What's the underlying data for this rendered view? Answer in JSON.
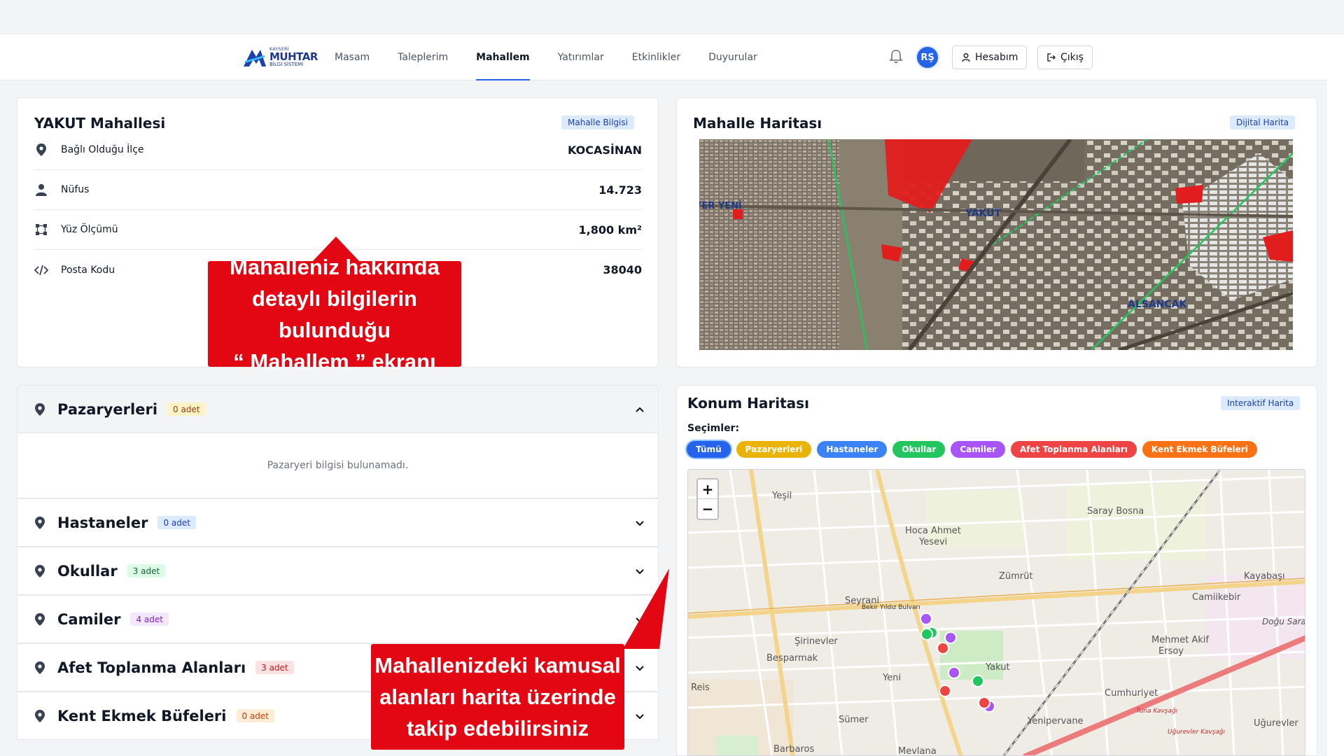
{
  "brand": {
    "line1": "KAYSERİ",
    "line2": "MUHTAR",
    "line3": "BİLGİ SİSTEMİ"
  },
  "nav": {
    "links": [
      "Masam",
      "Taleplerim",
      "Mahallem",
      "Yatırımlar",
      "Etkinlikler",
      "Duyurular"
    ],
    "active": "Mahallem",
    "avatar": "RŞ",
    "account_label": "Hesabım",
    "logout_label": "Çıkış"
  },
  "mahalle": {
    "title": "YAKUT Mahallesi",
    "tag": "Mahalle Bilgisi",
    "rows": [
      {
        "icon": "map-pin-icon",
        "label": "Bağlı Olduğu İlçe",
        "value": "KOCASİNAN"
      },
      {
        "icon": "person-icon",
        "label": "Nüfus",
        "value": "14.723"
      },
      {
        "icon": "area-icon",
        "label": "Yüz Ölçümü",
        "value": "1,800 km²"
      },
      {
        "icon": "code-icon",
        "label": "Posta Kodu",
        "value": "38040"
      }
    ]
  },
  "mahalle_haritasi": {
    "title": "Mahalle Haritası",
    "tag": "Dijital Harita",
    "labels": [
      "YAKUT",
      "ALSANCAK",
      "YER YENİ"
    ]
  },
  "accordion": {
    "items": [
      {
        "title": "Pazaryerleri",
        "count": "0 adet",
        "color": "#fef3c7",
        "text_color": "#92400e",
        "open": true,
        "empty_text": "Pazaryeri bilgisi bulunamadı."
      },
      {
        "title": "Hastaneler",
        "count": "0 adet",
        "color": "#dbeafe",
        "text_color": "#1e40af"
      },
      {
        "title": "Okullar",
        "count": "3 adet",
        "color": "#dcfce7",
        "text_color": "#166534"
      },
      {
        "title": "Camiler",
        "count": "4 adet",
        "color": "#f3e8ff",
        "text_color": "#7e22ce"
      },
      {
        "title": "Afet Toplanma Alanları",
        "count": "3 adet",
        "color": "#fee2e2",
        "text_color": "#b91c1c"
      },
      {
        "title": "Kent Ekmek Büfeleri",
        "count": "0 adet",
        "color": "#ffedd5",
        "text_color": "#c2410c"
      }
    ]
  },
  "konum": {
    "title": "Konum Haritası",
    "tag": "Interaktif Harita",
    "selections_label": "Seçimler:",
    "chips": [
      {
        "label": "Tümü",
        "color": "#2563eb"
      },
      {
        "label": "Pazaryerleri",
        "color": "#eab308"
      },
      {
        "label": "Hastaneler",
        "color": "#3b82f6"
      },
      {
        "label": "Okullar",
        "color": "#22c55e"
      },
      {
        "label": "Camiler",
        "color": "#a855f7"
      },
      {
        "label": "Afet Toplanma Alanları",
        "color": "#ef4444"
      },
      {
        "label": "Kent Ekmek Büfeleri",
        "color": "#f97316"
      }
    ],
    "zoom_in": "+",
    "zoom_out": "−",
    "map_labels": [
      "Yeşil",
      "Saray Bosna",
      "Hoca Ahmet",
      "Yesevi",
      "Zümrüt",
      "Kayabaşı",
      "Seyrani",
      "Camiikebir",
      "Şirinevler",
      "Besparmak",
      "Mehmet Akif",
      "Ersoy",
      "Doğu Saray",
      "Yakut",
      "Yeni",
      "Reis",
      "Cumhuriyet",
      "Sümer",
      "Yenipervane",
      "Uğurevler",
      "Barbaros",
      "Mevlana",
      "Bekir Yıldız Bulvarı",
      "Tuna Kavşağı",
      "Uğurevler Kavşağı"
    ]
  },
  "callouts": {
    "top": [
      "Mahalleniz hakkında",
      "detaylı bilgilerin bulunduğu",
      "“ Mahallem ” ekranı"
    ],
    "bottom": [
      "Mahallenizdeki kamusal",
      "alanları harita üzerinde",
      "takip edebilirsiniz"
    ],
    "color": "#e30613"
  }
}
